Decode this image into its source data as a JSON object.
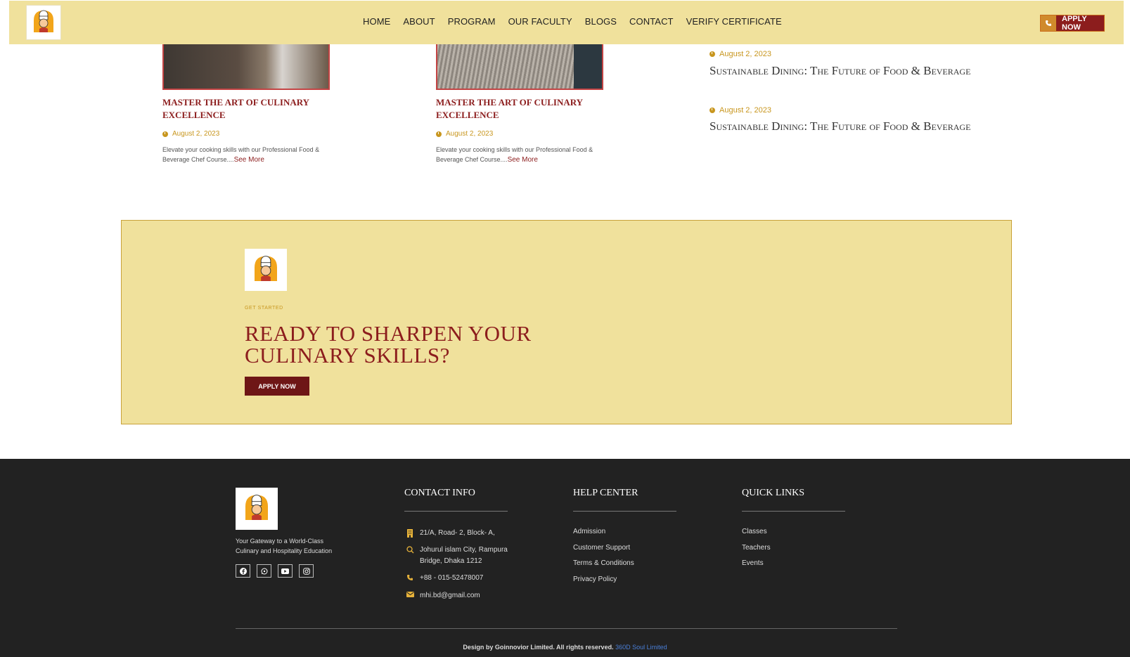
{
  "nav": {
    "items": [
      "HOME",
      "ABOUT",
      "PROGRAM",
      "OUR FACULTY",
      "BLOGS",
      "CONTACT",
      "VERIFY CERTIFICATE"
    ],
    "apply_label": "APPLY NOW"
  },
  "brand": {
    "logo_text": "GOOD CHEF"
  },
  "blogs": {
    "cards": [
      {
        "title": "MASTER THE ART OF CULINARY EXCELLENCE",
        "date": "August 2, 2023",
        "excerpt": "Elevate your cooking skills with our Professional Food & Beverage Chef Course....",
        "more": "See More"
      },
      {
        "title": "MASTER THE ART OF CULINARY EXCELLENCE",
        "date": "August 2, 2023",
        "excerpt": "Elevate your cooking skills with our Professional Food & Beverage Chef Course....",
        "more": "See More"
      }
    ],
    "side": [
      {
        "date": "August 2, 2023",
        "title": "Sustainable Dining: The Future of Food & Beverage"
      },
      {
        "date": "August 2, 2023",
        "title": "Sustainable Dining: The Future of Food & Beverage"
      }
    ]
  },
  "cta": {
    "eyebrow": "GET STARTED",
    "title": "READY TO SHARPEN YOUR CULINARY SKILLS?",
    "button": "APPLY NOW"
  },
  "footer": {
    "tagline": "Your Gateway to a World-Class Culinary and Hospitality Education",
    "socials": [
      "facebook-icon",
      "whatsapp-icon",
      "youtube-icon",
      "instagram-icon"
    ],
    "contact": {
      "heading": "CONTACT INFO",
      "address1": "21/A, Road- 2, Block- A,",
      "address2": "Johurul islam City, Rampura Bridge, Dhaka 1212",
      "phone": "+88 - 015-52478007",
      "email": "mhi.bd@gmail.com"
    },
    "help": {
      "heading": "HELP CENTER",
      "links": [
        "Admission",
        "Customer Support",
        "Terms & Conditions",
        "Privacy Policy"
      ]
    },
    "quick": {
      "heading": "QUICK LINKS",
      "links": [
        "Classes",
        "Teachers",
        "Events"
      ]
    },
    "copyright": "Design by Goinnovior Limited. All rights reserved.",
    "credit": "360D Soul Limited"
  },
  "colors": {
    "accent": "#8c1d1d",
    "gold": "#c8961e",
    "cream": "#f0e19c",
    "footer_bg": "#222222"
  }
}
